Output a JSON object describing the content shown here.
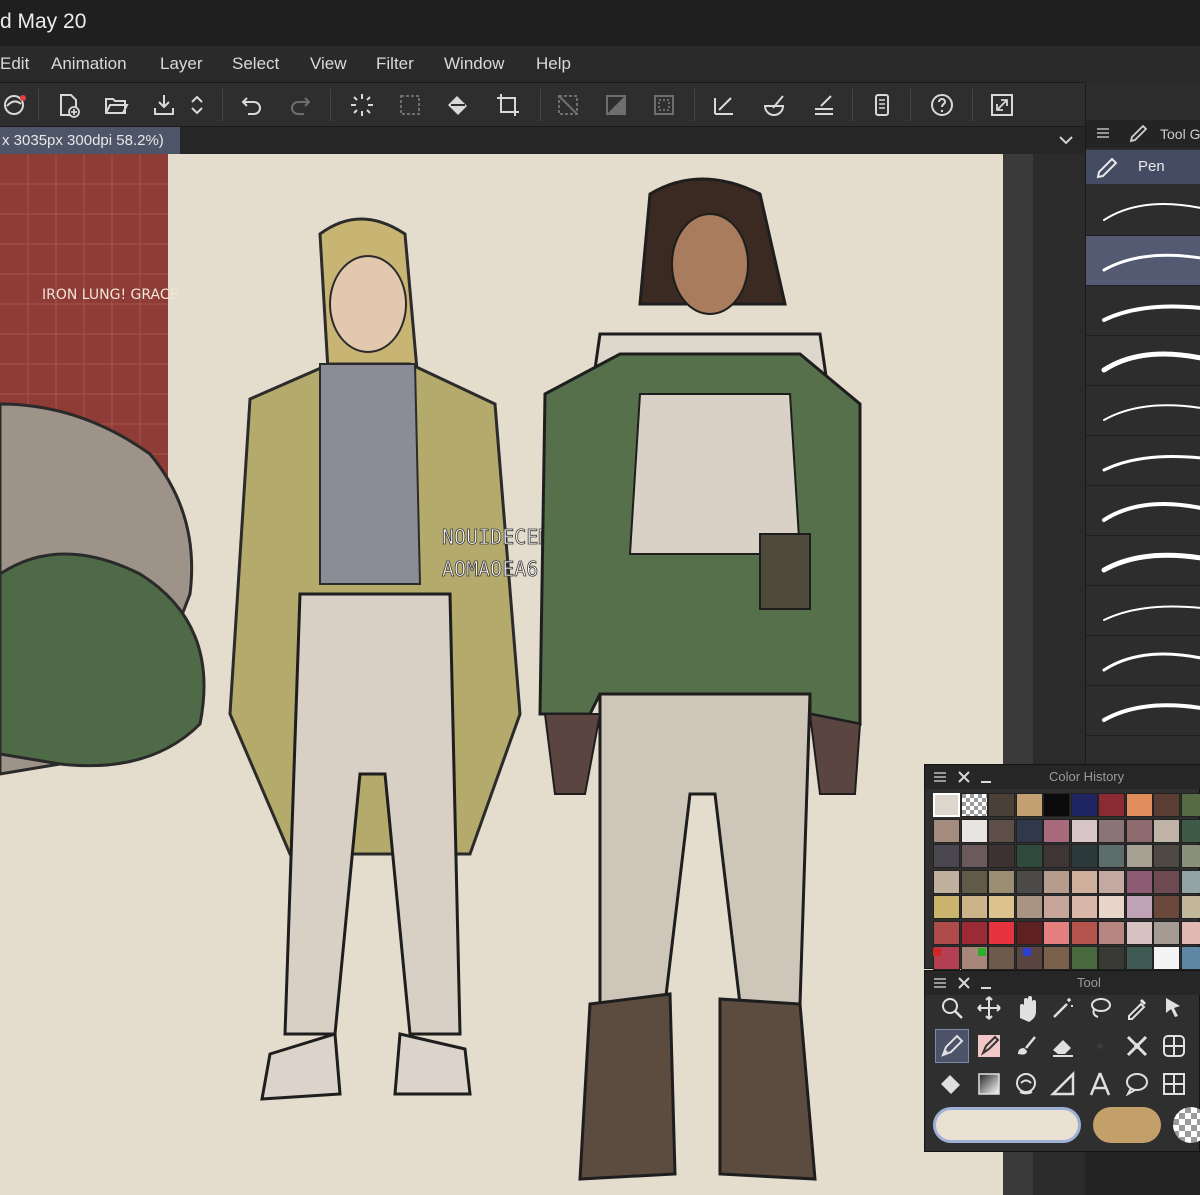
{
  "window": {
    "title": "d May 20"
  },
  "menu": {
    "items": [
      "Edit",
      "Animation",
      "Layer",
      "Select",
      "View",
      "Filter",
      "Window",
      "Help"
    ]
  },
  "toolbar": {
    "buttons": [
      {
        "name": "app-logo-icon"
      },
      {
        "name": "new-file-icon"
      },
      {
        "name": "open-folder-icon"
      },
      {
        "name": "save-icon"
      },
      {
        "name": "save-stepper-icon"
      },
      {
        "name": "undo-icon"
      },
      {
        "name": "redo-icon"
      },
      {
        "name": "loading-spinner-icon"
      },
      {
        "name": "clear-selection-icon"
      },
      {
        "name": "fill-bucket-icon"
      },
      {
        "name": "crop-icon"
      },
      {
        "name": "deselect-icon"
      },
      {
        "name": "invert-selection-icon"
      },
      {
        "name": "selection-border-icon"
      },
      {
        "name": "ruler-snap-icon"
      },
      {
        "name": "special-ruler-snap-icon"
      },
      {
        "name": "grid-snap-icon"
      },
      {
        "name": "smartphone-icon"
      },
      {
        "name": "help-icon"
      },
      {
        "name": "fullscreen-icon"
      }
    ]
  },
  "document": {
    "tab_label": "x 3035px 300dpi 58.2%)"
  },
  "tool_group_panel": {
    "tab_label": "Tool G",
    "subtool_label": "Pen",
    "brush_count": 11,
    "selected_brush_index": 1
  },
  "color_history": {
    "title": "Color History",
    "swatches": [
      [
        "#ddd6cc",
        "checker",
        "#4a4037",
        "#c3a072",
        "#0b0b0d",
        "#1f2561",
        "#8c2a34",
        "#e08d5b",
        "#5b3e33",
        "#566b44"
      ],
      [
        "#a48c7e",
        "#e7e3e0",
        "#5d4f48",
        "#30384c",
        "#a8697c",
        "#d5c5c6",
        "#8a7477",
        "#8d6b6e",
        "#bfb3a7",
        "#3d5b46"
      ],
      [
        "#4a4650",
        "#6a5a5e",
        "#3d3232",
        "#2f4a3c",
        "#3f3534",
        "#2c3a3c",
        "#5d6e6a",
        "#a6a192",
        "#4e4944",
        "#8b907a"
      ],
      [
        "#c2b09e",
        "#605a48",
        "#9b8e72",
        "#4c4a48",
        "#b69c8c",
        "#d0b09c",
        "#c4a9a0",
        "#8d5b73",
        "#6d4a52",
        "#94a3a6"
      ],
      [
        "#c9b46b",
        "#cbb48a",
        "#dcc38d",
        "#a99484",
        "#c7a59b",
        "#d9b8aa",
        "#e6d5c8",
        "#bfa2b5",
        "#6b483c",
        "#c3b89a"
      ],
      [
        "#b04b4c",
        "#9a2b34",
        "#e7333d",
        "#5f2021",
        "#e4807d",
        "#b4534c",
        "#b88681",
        "#d6c3c1",
        "#a69b92",
        "#e2b8b2"
      ],
      [
        "#b24052",
        "#a7867a",
        "#6d5a4a",
        "#5b4540",
        "#79614c",
        "#48693d",
        "#383834",
        "#3e5a52",
        "#f3f3f3",
        "#5d87a3"
      ]
    ],
    "rgb_indicators": [
      "#d12626",
      "#2cad2c",
      "#2a3fd6"
    ]
  },
  "tool_panel": {
    "title": "Tool",
    "tools": [
      [
        "zoom-icon",
        "move-icon",
        "hand-icon",
        "magic-wand-icon",
        "lasso-icon",
        "eyedropper-icon",
        "select-arrow-icon"
      ],
      [
        "pen-tool-icon",
        "marker-icon",
        "brush-icon",
        "eraser-icon",
        "dot-icon",
        "decoration-icon",
        "frame-icon"
      ],
      [
        "fill-icon",
        "gradient-icon",
        "blend-icon",
        "figure-icon",
        "text-icon",
        "balloon-icon",
        "ruler-icon"
      ]
    ],
    "active_tool": "pen-tool-icon",
    "main_color": "#ebe1d3",
    "sub_color": "#c3a06a"
  },
  "artwork": {
    "note_text": "IRON LUNG! GRACE",
    "center_text_line1": "NOUIDECEM",
    "center_text_line2": "AOMAOEA6"
  }
}
